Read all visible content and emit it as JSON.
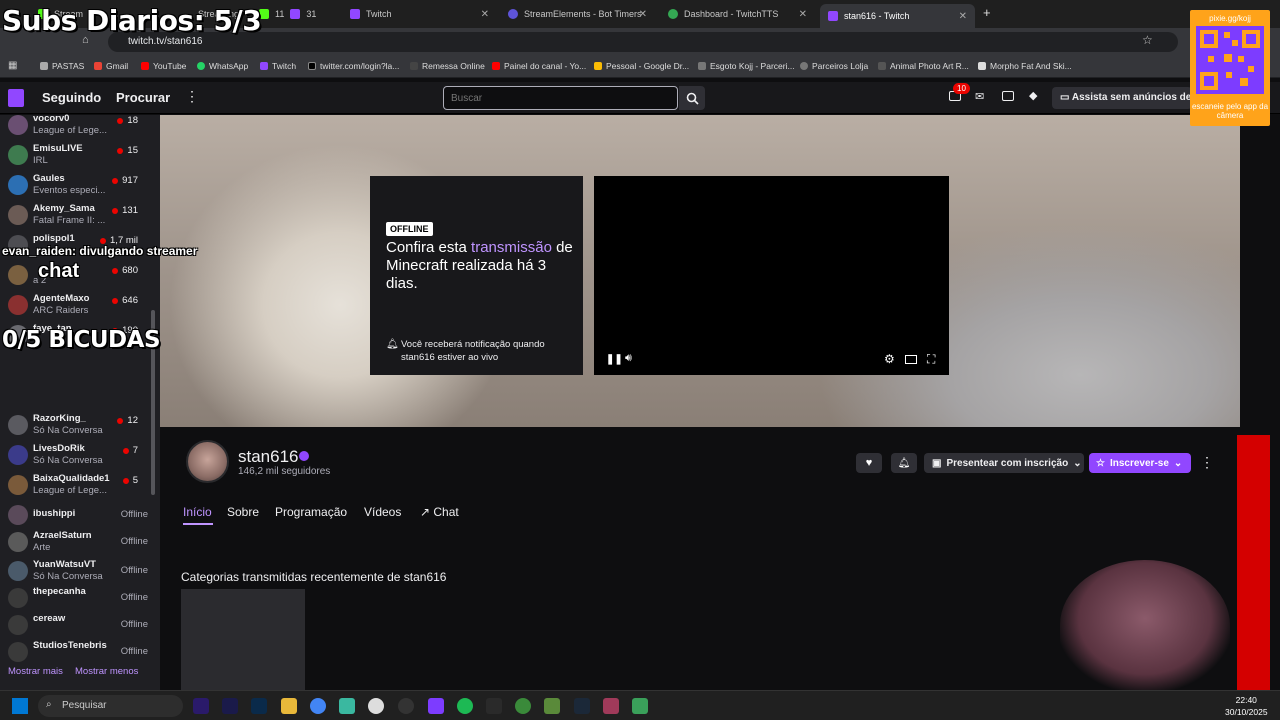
{
  "browser": {
    "tabs": [
      {
        "label": "Stream",
        "suffix": "+d"
      },
      {
        "label": "Streaming",
        "badges": [
          "11",
          "31"
        ]
      },
      {
        "label": "Twitch"
      },
      {
        "label": "StreamElements - Bot Timers"
      },
      {
        "label": "Dashboard - TwitchTTS"
      },
      {
        "label": "stan616 - Twitch"
      }
    ],
    "new_tab_symbol": "+",
    "address": "twitch.tv/stan616",
    "bookmarks": [
      "PASTAS",
      "Gmail",
      "YouTube",
      "WhatsApp",
      "Twitch",
      "twitter.com/login?la...",
      "Remessa Online",
      "Painel do canal - Yo...",
      "Pessoal - Google Dr...",
      "Esgoto Kojj - Parceri...",
      "Parceiros Lolja",
      "Animal Photo Art R...",
      "Morpho Fat And Ski..."
    ]
  },
  "twitch_nav": {
    "following": "Seguindo",
    "browse": "Procurar",
    "search_placeholder": "Buscar",
    "notif_count": "10",
    "ad_free": "Assista sem anúncios de"
  },
  "sidebar": {
    "channels": [
      {
        "name": "vocorv0",
        "game": "League of Lege...",
        "viewers": "18"
      },
      {
        "name": "EmisuLIVE",
        "game": "IRL",
        "viewers": "15"
      },
      {
        "name": "Gaules",
        "game": "Eventos especi...",
        "viewers": "917"
      },
      {
        "name": "Akemy_Sama",
        "game": "Fatal Frame II: ...",
        "viewers": "131"
      },
      {
        "name": "polispol1",
        "game": "",
        "viewers": "1,7 mil"
      },
      {
        "name": "",
        "game": "a 2",
        "viewers": "680"
      },
      {
        "name": "AgenteMaxo",
        "game": "ARC Raiders",
        "viewers": "646"
      },
      {
        "name": "faye_tan",
        "game": "",
        "viewers": "190"
      },
      {
        "name": "RazorKing_",
        "game": "Só Na Conversa",
        "viewers": "12"
      },
      {
        "name": "LivesDoRik",
        "game": "Só Na Conversa",
        "viewers": "7"
      },
      {
        "name": "BaixaQualidade1",
        "game": "League of Lege...",
        "viewers": "5"
      },
      {
        "name": "ibushippi",
        "game": "",
        "status": "Offline"
      },
      {
        "name": "AzraelSaturn",
        "game": "Arte",
        "status": "Offline"
      },
      {
        "name": "YuanWatsuVT",
        "game": "Só Na Conversa",
        "status": "Offline"
      },
      {
        "name": "thepecanha",
        "game": "",
        "status": "Offline"
      },
      {
        "name": "cereaw",
        "game": "",
        "status": "Offline"
      },
      {
        "name": "StudiosTenebris",
        "game": "",
        "status": "Offline"
      }
    ],
    "show_more": "Mostrar mais",
    "show_less": "Mostrar menos"
  },
  "hero": {
    "offline_badge": "OFFLINE",
    "text_before": "Confira esta ",
    "text_highlight": "transmissão",
    "text_after": " de Minecraft realizada há 3 dias.",
    "notify": "Você receberá notificação quando stan616 estiver ao vivo"
  },
  "channel": {
    "name": "stan616",
    "followers": "146,2 mil seguidores",
    "gift": "Presentear com inscrição",
    "subscribe": "Inscrever-se",
    "tabs": [
      "Início",
      "Sobre",
      "Programação",
      "Vídeos",
      "Chat"
    ],
    "categories_heading": "Categorias transmitidas recentemente de stan616"
  },
  "overlays": {
    "subs": "Subs Diarios: 5/3",
    "chat_line": "evan_raiden: divulgando streamer",
    "chat_label": "chat",
    "bicudas": "0/5 BICUDAS",
    "qr_url": "pixie.gg/kojj",
    "qr_caption": "escaneie pelo app da câmera"
  },
  "taskbar": {
    "search": "Pesquisar",
    "time": "22:40",
    "date": "30/10/2025"
  },
  "colors": {
    "accent": "#9147ff",
    "accent_light": "#bf94ff",
    "live": "#eb0400",
    "qr_bg": "#ffa31a"
  }
}
